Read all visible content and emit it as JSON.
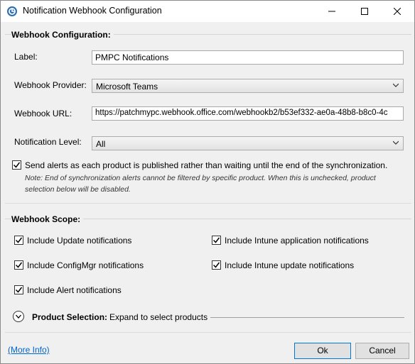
{
  "window": {
    "title": "Notification Webhook Configuration"
  },
  "webhook_config": {
    "group_title": "Webhook Configuration:",
    "label_caption": "Label:",
    "label_value": "PMPC Notifications",
    "provider_caption": "Webhook Provider:",
    "provider_value": "Microsoft Teams",
    "url_caption": "Webhook URL:",
    "url_value": "https://patchmypc.webhook.office.com/webhookb2/b53ef332-ae0a-48b8-b8c0-4c",
    "level_caption": "Notification Level:",
    "level_value": "All",
    "send_alerts_label": "Send alerts as each product is published rather than waiting until the end of the synchronization.",
    "send_alerts_checked": true,
    "note_line1": "Note: End of synchronization alerts cannot be filtered by specific product. When this is unchecked, product",
    "note_line2": "selection below will be disabled."
  },
  "webhook_scope": {
    "group_title": "Webhook Scope:",
    "options": [
      {
        "label": "Include Update notifications",
        "checked": true
      },
      {
        "label": "Include Intune application notifications",
        "checked": true
      },
      {
        "label": "Include ConfigMgr notifications",
        "checked": true
      },
      {
        "label": "Include Intune update notifications",
        "checked": true
      },
      {
        "label": "Include Alert notifications",
        "checked": true
      }
    ],
    "product_selection_title": "Product Selection:",
    "product_selection_hint": "Expand to select products"
  },
  "footer": {
    "more_info": "(More Info)",
    "ok_label": "Ok",
    "cancel_label": "Cancel"
  },
  "colors": {
    "accent": "#0078d7",
    "link": "#0066cc"
  }
}
